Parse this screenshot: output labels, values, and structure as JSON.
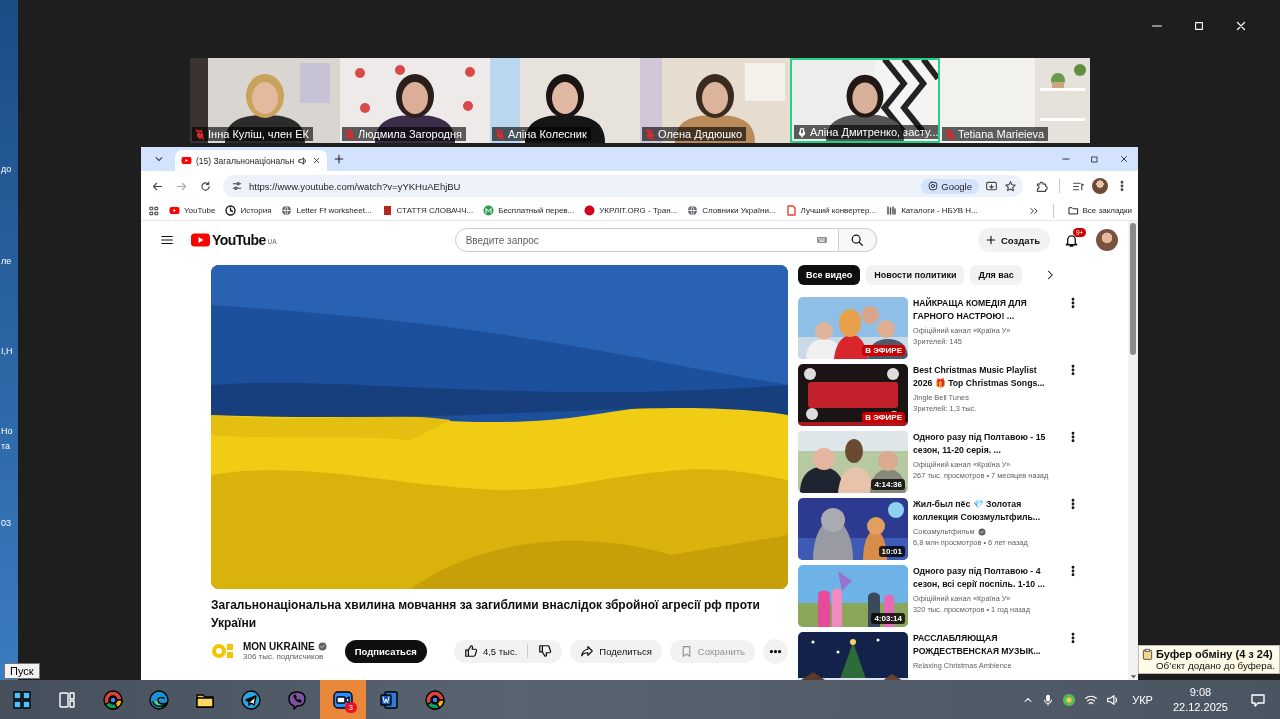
{
  "desktop": {
    "icon_labels": [
      "до",
      "ле",
      "І,Н",
      "Но",
      "та",
      "03"
    ],
    "start_tooltip": "Пуск"
  },
  "zoom": {
    "participants": [
      {
        "name": "Інна Куліш, член ЕК",
        "muted": true,
        "speaking": false
      },
      {
        "name": "Людмила Загородня",
        "muted": true,
        "speaking": false
      },
      {
        "name": "Аліна Колесник",
        "muted": true,
        "speaking": false
      },
      {
        "name": "Олена Дядюшко",
        "muted": true,
        "speaking": false
      },
      {
        "name": "Аліна Дмитренко, засту...",
        "muted": false,
        "speaking": true
      },
      {
        "name": "Tetiana Marieieva",
        "muted": true,
        "speaking": false
      }
    ]
  },
  "browser": {
    "tab": {
      "title": "(15) Загальнонаціональн",
      "audio": true
    },
    "url": "https://www.youtube.com/watch?v=yYKHuAEhjBU",
    "google_chip": "Google",
    "bookmarks": [
      {
        "label": "YouTube",
        "kind": "youtube"
      },
      {
        "label": "История",
        "kind": "history"
      },
      {
        "label": "Letter Ff worksheet...",
        "kind": "globe"
      },
      {
        "label": "СТАТТЯ СЛОВАЧЧ...",
        "kind": "doc"
      },
      {
        "label": "Бесплатный перев...",
        "kind": "m"
      },
      {
        "label": "УКРЛІТ.ORG - Тран...",
        "kind": "dot"
      },
      {
        "label": "Словники України...",
        "kind": "globe"
      },
      {
        "label": "Лучший конвертер...",
        "kind": "pdf"
      },
      {
        "label": "Каталоги - НБУВ Н...",
        "kind": "catalog"
      }
    ],
    "all_bookmarks": "Все закладки"
  },
  "youtube": {
    "logo": "YouTube",
    "region": "UA",
    "search": {
      "placeholder": "Введите запрос"
    },
    "create": "Создать",
    "notifications": "9+",
    "video": {
      "title": "Загальнонаціональна хвилина мовчання за загиблими внаслідок збройної агресії рф проти України",
      "channel": "MON UKRAINE",
      "verified": true,
      "subscribers": "306 тыс. подписчиков",
      "subscribe": "Подписаться",
      "likes": "4,5 тыс.",
      "share": "Поделиться",
      "save": "Сохранить",
      "save_disabled": true
    },
    "chips": [
      {
        "label": "Все видео",
        "selected": true
      },
      {
        "label": "Новости политики",
        "selected": false
      },
      {
        "label": "Для вас",
        "selected": false
      }
    ],
    "recommendations": [
      {
        "title": "НАЙКРАЩА КОМЕДІЯ ДЛЯ ГАРНОГО НАСТРОЮ! ...",
        "channel": "Офіційний канал «Країна У»",
        "verified": false,
        "meta": "Зрителей: 145",
        "badge": "В ЭФИРЕ",
        "kind": "live"
      },
      {
        "title": "Best Christmas Music Playlist 2026 🎁 Top Christmas Songs...",
        "channel": "Jingle Bell Tunes",
        "verified": false,
        "meta": "Зрителей: 1,3 тыс.",
        "badge": "В ЭФИРЕ",
        "kind": "live"
      },
      {
        "title": "Одного разу під Полтавою - 15 сезон, 11-20 серія. ...",
        "channel": "Офіційний канал «Країна У»",
        "verified": false,
        "meta": "267 тыс. просмотров • 7 месяцев назад",
        "badge": "4:14:36",
        "kind": "video"
      },
      {
        "title": "Жил-был пёс 💎 Золотая коллекция Союзмультфиль...",
        "channel": "Союзмультфильм",
        "verified": true,
        "meta": "6,8 млн просмотров • 6 лет назад",
        "badge": "10:01",
        "kind": "video"
      },
      {
        "title": "Одного разу під Полтавою - 4 сезон, всі серії поспіль. 1-10 ...",
        "channel": "Офіційний канал «Країна У»",
        "verified": false,
        "meta": "320 тыс. просмотров • 1 год назад",
        "badge": "4:03:14",
        "kind": "video"
      },
      {
        "title": "РАССЛАБЛЯЮЩАЯ РОЖДЕСТВЕНСКАЯ МУЗЫК...",
        "channel": "Relaxing Christmas Ambience",
        "verified": false
      }
    ]
  },
  "clipboard": {
    "title": "Буфер обміну (4 з 24)",
    "message": "Об’єкт додано до буфера."
  },
  "taskbar": {
    "apps": [
      {
        "kind": "start",
        "selected": false
      },
      {
        "kind": "taskview",
        "selected": false
      },
      {
        "kind": "chrome",
        "selected": false
      },
      {
        "kind": "edge",
        "selected": false
      },
      {
        "kind": "explorer",
        "selected": false
      },
      {
        "kind": "telegram",
        "selected": false
      },
      {
        "kind": "viber",
        "selected": false
      },
      {
        "kind": "zoom",
        "selected": true,
        "badge": "3"
      },
      {
        "kind": "word",
        "selected": false
      },
      {
        "kind": "chrome",
        "selected": false
      }
    ],
    "language": "УКР",
    "time": "9:08",
    "date": "22.12.2025"
  }
}
